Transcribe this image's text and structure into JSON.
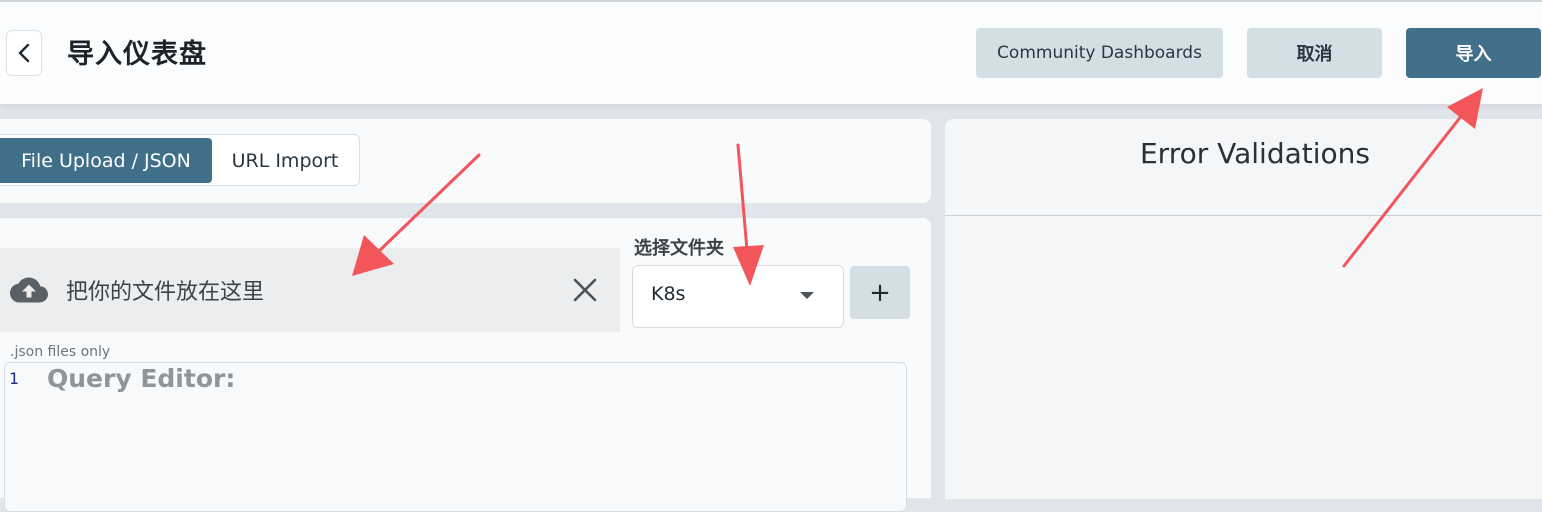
{
  "header": {
    "title": "导入仪表盘",
    "community_label": "Community Dashboards",
    "cancel_label": "取消",
    "import_label": "导入"
  },
  "tabs": [
    {
      "label": "File Upload / JSON",
      "active": true
    },
    {
      "label": "URL Import",
      "active": false
    }
  ],
  "upload": {
    "drop_text": "把你的文件放在这里",
    "hint": ".json files only"
  },
  "folder": {
    "label": "选择文件夹",
    "selected": "K8s",
    "add_label": "+"
  },
  "editor": {
    "line_number": "1",
    "placeholder": "Query Editor:"
  },
  "errors": {
    "title": "Error Validations"
  },
  "colors": {
    "accent": "#42708b",
    "secondary_button": "#d4dfe5",
    "annotation_arrow": "#f2555a"
  },
  "icons": {
    "back": "chevron-left-icon",
    "upload": "cloud-upload-icon",
    "clear": "close-icon",
    "dropdown": "caret-down-icon"
  }
}
